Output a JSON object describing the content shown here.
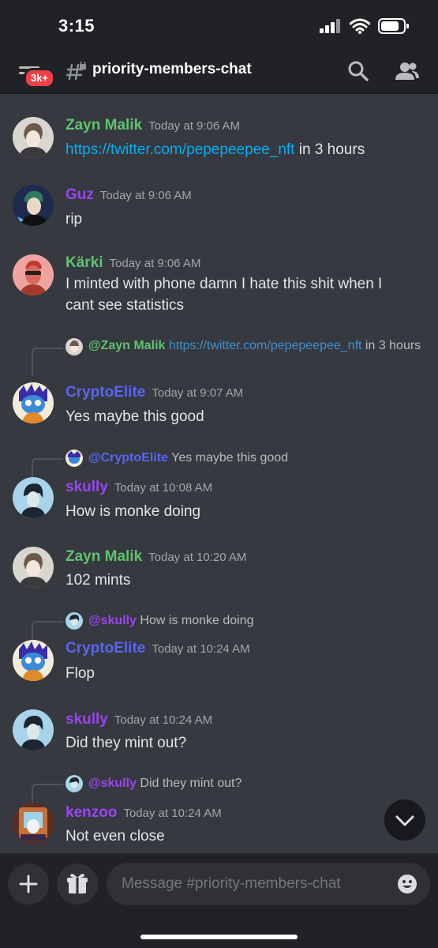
{
  "status": {
    "time": "3:15"
  },
  "header": {
    "badge": "3k+",
    "channel": "priority-members-chat"
  },
  "messages": [
    {
      "author": "Zayn Malik",
      "time": "Today at 9:06 AM",
      "link": "https://twitter.com/pepepeepee_nft",
      "text": " in 3 hours"
    },
    {
      "author": "Guz",
      "time": "Today at 9:06 AM",
      "text": "rip"
    },
    {
      "author": "Kärki",
      "time": "Today at 9:06 AM",
      "text": "I minted with phone damn I hate this shit when I cant see statistics"
    },
    {
      "author": "CryptoElite",
      "time": "Today at 9:07 AM",
      "text": "Yes maybe this good",
      "reply": {
        "mention": "@Zayn Malik",
        "link": "https://twitter.com/pepepeepee_nft",
        "text": " in 3 hours"
      }
    },
    {
      "author": "skully",
      "time": "Today at 10:08 AM",
      "text": "How is monke doing",
      "reply": {
        "mention": "@CryptoElite",
        "text": " Yes maybe this good"
      }
    },
    {
      "author": "Zayn Malik",
      "time": "Today at 10:20 AM",
      "text": "102 mints"
    },
    {
      "author": "CryptoElite",
      "time": "Today at 10:24 AM",
      "text": "Flop",
      "reply": {
        "mention": "@skully",
        "text": " How is monke doing"
      }
    },
    {
      "author": "skully",
      "time": "Today at 10:24 AM",
      "text": "Did they mint out?"
    },
    {
      "author": "kenzoo",
      "time": "Today at 10:24 AM",
      "text": "Not even close",
      "reply": {
        "mention": "@skully",
        "text": " Did they mint out?"
      }
    }
  ],
  "composer": {
    "placeholder": "Message #priority-members-chat"
  },
  "colors": {
    "background": "#36393f",
    "header": "#202225",
    "green_name": "#5fc370",
    "purple_name": "#9b44f0",
    "link": "#00aff4",
    "badge": "#ed4245"
  }
}
